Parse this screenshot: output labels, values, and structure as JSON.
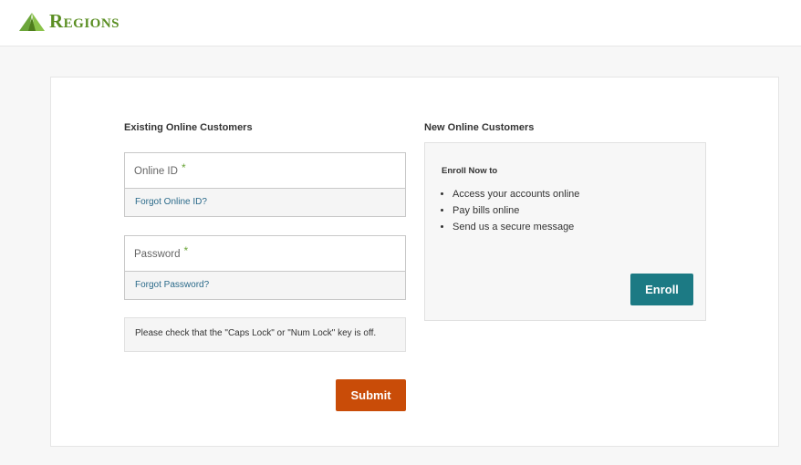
{
  "brand": {
    "name": "Regions",
    "color": "#5a8e22"
  },
  "existing": {
    "title": "Existing Online Customers",
    "online_id_label": "Online ID",
    "online_id_value": "",
    "forgot_id": "Forgot Online ID?",
    "password_label": "Password",
    "password_value": "",
    "forgot_password": "Forgot Password?",
    "required_marker": "*",
    "notice": "Please check that the \"Caps Lock\" or \"Num Lock\" key is off.",
    "submit_label": "Submit",
    "submit_color": "#c94c08"
  },
  "new_customers": {
    "title": "New Online Customers",
    "heading": "Enroll Now to",
    "benefits": [
      "Access your accounts online",
      "Pay bills online",
      "Send us a secure message"
    ],
    "enroll_label": "Enroll",
    "enroll_color": "#1c7a84"
  }
}
